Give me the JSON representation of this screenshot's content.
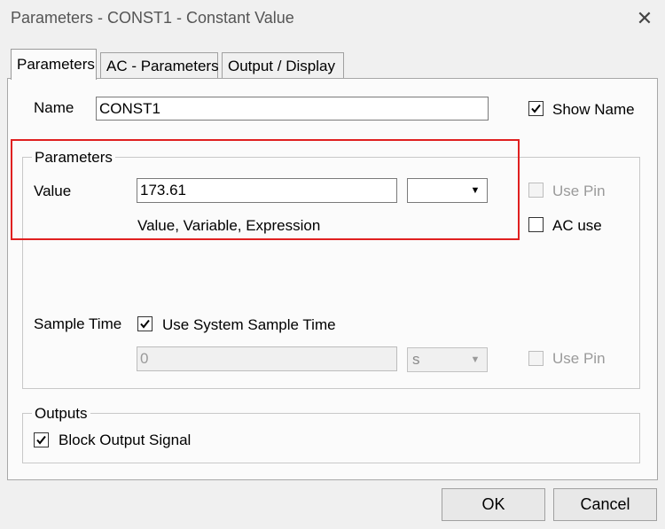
{
  "window": {
    "title": "Parameters - CONST1 - Constant Value",
    "close_glyph": "✕"
  },
  "tabs": [
    {
      "label": "Parameters",
      "active": true
    },
    {
      "label": "AC - Parameters",
      "active": false
    },
    {
      "label": "Output / Display",
      "active": false
    }
  ],
  "name_row": {
    "label": "Name",
    "value": "CONST1",
    "show_name_label": "Show Name",
    "show_name_checked": true
  },
  "parameters_group": {
    "title": "Parameters",
    "value_label": "Value",
    "value": "173.61",
    "unit_selected": "",
    "hint": "Value, Variable, Expression",
    "use_pin_label": "Use Pin",
    "use_pin_checked": false,
    "use_pin_enabled": false,
    "ac_use_label": "AC use",
    "ac_use_checked": false,
    "sample_time_label": "Sample Time",
    "use_system_sample_time_label": "Use System Sample Time",
    "use_system_sample_time_checked": true,
    "sample_time_value": "0",
    "sample_time_unit": "s",
    "sample_use_pin_label": "Use Pin",
    "sample_use_pin_checked": false
  },
  "outputs_group": {
    "title": "Outputs",
    "block_output_signal_label": "Block Output Signal",
    "block_output_signal_checked": true
  },
  "buttons": {
    "ok": "OK",
    "cancel": "Cancel"
  },
  "colors": {
    "highlight_border": "#e02020",
    "dialog_bg": "#f0f0f0",
    "panel_bg": "#fbfbfb"
  }
}
